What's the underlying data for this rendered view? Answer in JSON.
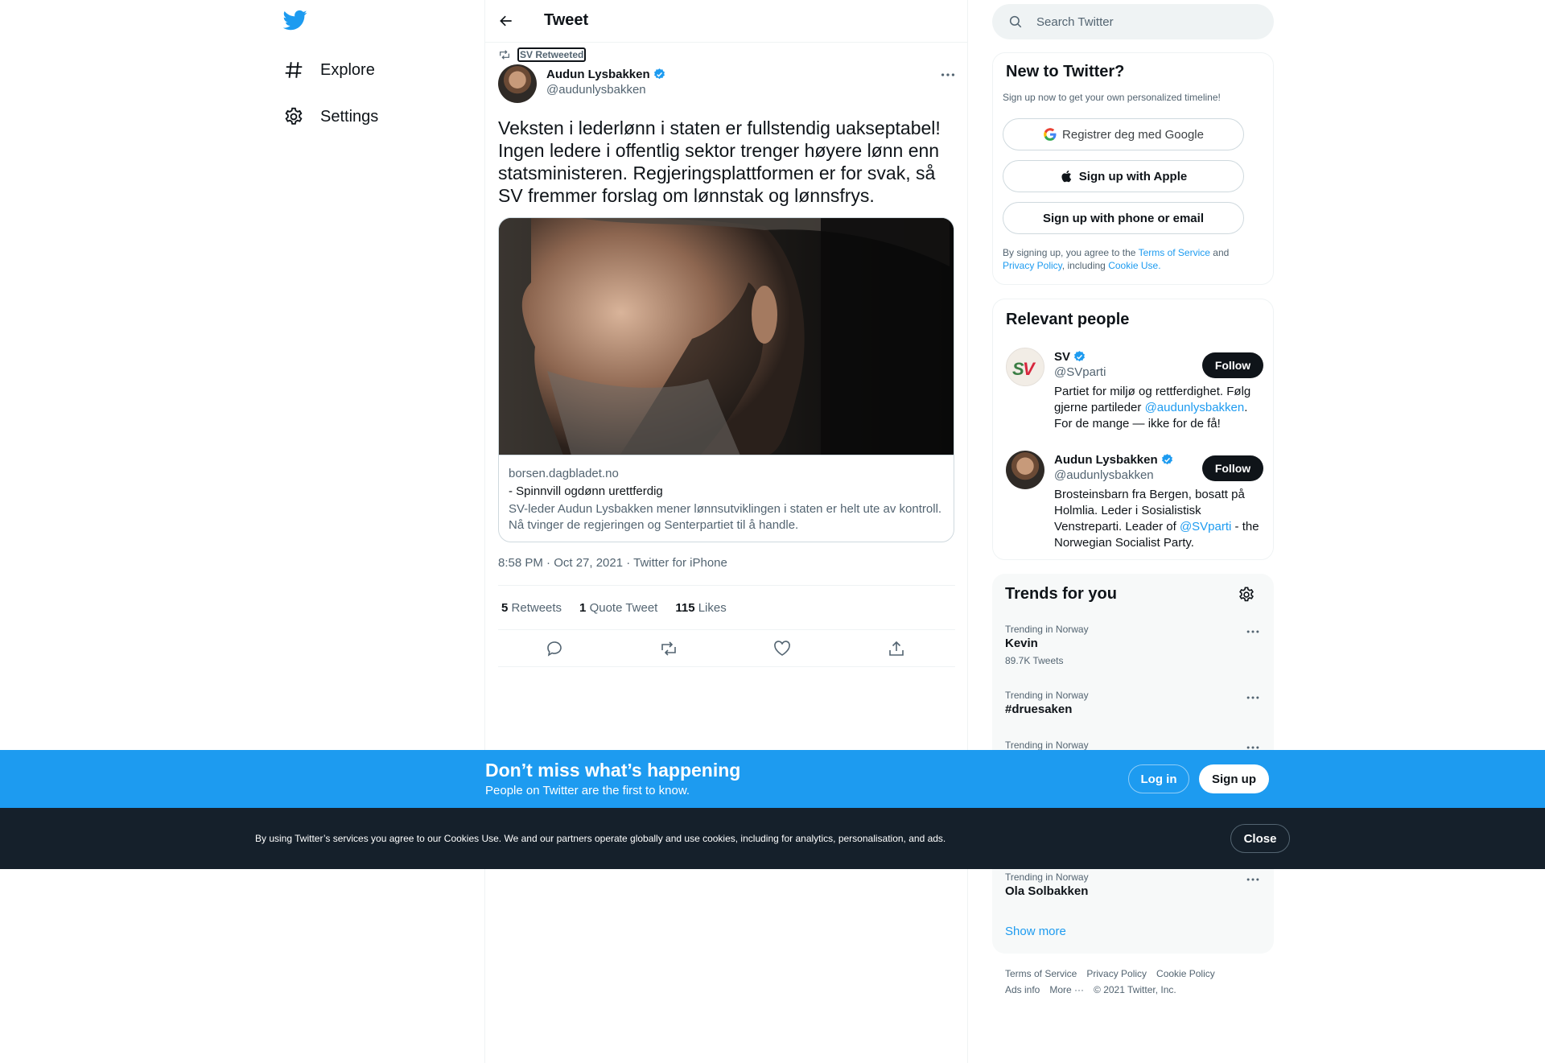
{
  "nav": {
    "items": [
      {
        "label": "Explore",
        "icon": "hashtag-icon"
      },
      {
        "label": "Settings",
        "icon": "gear-icon"
      }
    ]
  },
  "header": {
    "title": "Tweet"
  },
  "tweet": {
    "retweeted_by": "SV Retweeted",
    "author_name": "Audun Lysbakken",
    "author_handle": "@audunlysbakken",
    "text": "Veksten i lederlønn i staten er fullstendig uakseptabel! Ingen ledere i offentlig sektor trenger høyere lønn enn statsministeren. Regjeringsplattformen er for svak, så SV fremmer forslag om lønnstak og lønnsfrys.",
    "card": {
      "domain": "borsen.dagbladet.no",
      "title": "- Spinnvill ogdønn urettferdig",
      "description": "SV-leder Audun Lysbakken mener lønnsutviklingen i staten er helt ute av kontroll. Nå tvinger de regjeringen og Senterpartiet til å handle."
    },
    "timestamp": "8:58 PM · Oct 27, 2021 · Twitter for iPhone",
    "stats": {
      "retweets_count": "5",
      "retweets_label": "Retweets",
      "quotes_count": "1",
      "quotes_label": "Quote Tweet",
      "likes_count": "115",
      "likes_label": "Likes"
    }
  },
  "search": {
    "placeholder": "Search Twitter"
  },
  "signup_panel": {
    "title": "New to Twitter?",
    "subtitle": "Sign up now to get your own personalized timeline!",
    "google_label": "Registrer deg med Google",
    "apple_label": "Sign up with Apple",
    "phone_label": "Sign up with phone or email",
    "legal_prefix": "By signing up, you agree to the",
    "terms": "Terms of Service",
    "and": "and",
    "privacy": "Privacy Policy",
    "including": ", including",
    "cookie": "Cookie Use."
  },
  "relevant": {
    "title": "Relevant people",
    "follow_label": "Follow",
    "people": [
      {
        "name": "SV",
        "handle": "@SVparti",
        "bio_before": "Partiet for miljø og rettferdighet. Følg gjerne partileder ",
        "bio_link": "@audunlysbakken",
        "bio_after": ". For de mange — ikke for de få!"
      },
      {
        "name": "Audun Lysbakken",
        "handle": "@audunlysbakken",
        "bio_before": "Brosteinsbarn fra Bergen, bosatt på Holmlia. Leder i Sosialistisk Venstreparti. Leader of ",
        "bio_link": "@SVparti",
        "bio_after": " - the Norwegian Socialist Party."
      }
    ]
  },
  "trends": {
    "title": "Trends for you",
    "items": [
      {
        "context": "Trending in Norway",
        "name": "Kevin",
        "count": "89.7K Tweets"
      },
      {
        "context": "Trending in Norway",
        "name": "#druesaken",
        "count": ""
      },
      {
        "context": "Trending in Norway",
        "name": "",
        "count": ""
      },
      {
        "context": "Trending in Norway",
        "name": "Ola Solbakken",
        "count": ""
      }
    ],
    "show_more": "Show more"
  },
  "footer": {
    "links": [
      "Terms of Service",
      "Privacy Policy",
      "Cookie Policy",
      "Ads info",
      "More ···"
    ],
    "copyright": "© 2021 Twitter, Inc."
  },
  "banner": {
    "heading": "Don’t miss what’s happening",
    "subheading": "People on Twitter are the first to know.",
    "login_label": "Log in",
    "signup_label": "Sign up"
  },
  "cookie_bar": {
    "text": "By using Twitter’s services you agree to our Cookies Use. We and our partners operate globally and use cookies, including for analytics, personalisation, and ads.",
    "close_label": "Close"
  },
  "colors": {
    "accent": "#1d9bf0",
    "text": "#0f1419",
    "muted": "#536471",
    "cookie_bg": "#15202b"
  }
}
